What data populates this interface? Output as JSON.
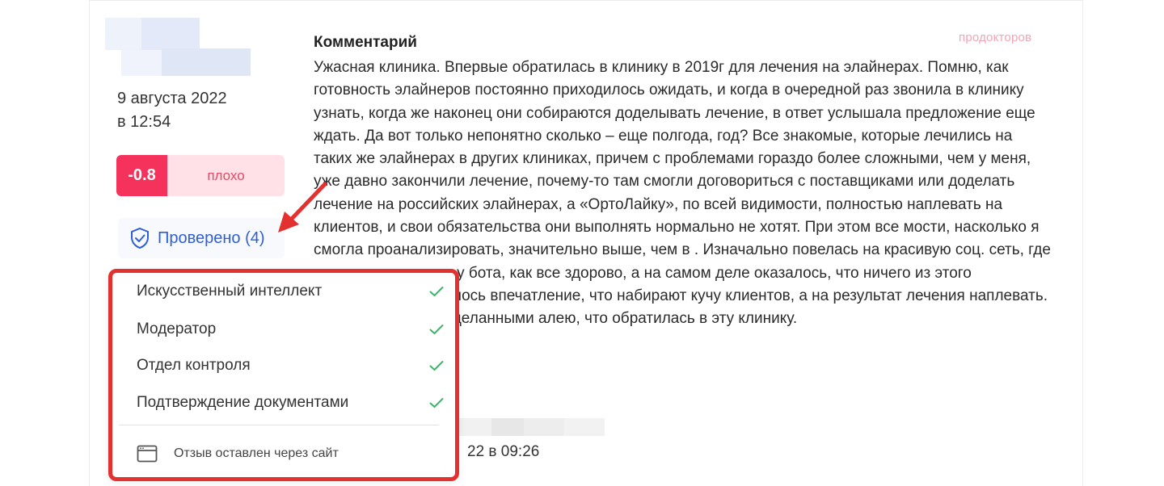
{
  "review": {
    "date_line1": "9 августа 2022",
    "date_line2": "в 12:54",
    "rating": {
      "score": "-0.8",
      "label": "плохо",
      "score_color": "#f5325c",
      "label_bg": "#ffe1e7"
    },
    "verified_label": "Проверено (4)",
    "comment_title": "Комментарий",
    "brand": "продокторов",
    "comment_text": "Ужасная клиника. Впервые обратилась в клинику в 2019г для лечения на элайнерах. Помню, как готовность элайнеров постоянно приходилось ожидать, и когда в очередной раз звонила в клинику узнать, когда же наконец они собираются доделывать лечение, в ответ услышала предложение еще ждать. Да вот только непонятно сколько – еще полгода, год? Все знакомые, которые лечились на таких же элайнерах в других клиниках, причем с проблемами гораздо более сложными, чем у меня, уже давно закончили лечение, почему-то там смогли договориться с поставщиками или доделать лечение на российских элайнерах, а «ОртоЛайку», по всей видимости, полностью наплевать на клиентов, и свои обязательства они выполнять нормально не хотят. При этом все                    мости, насколько я смогла проанализировать, значительно выше, чем в                    . Изначально повелась на красивую соц. сеть, где расписывают какая у                    бота, как все здорово, а на самом деле оказалось, что ничего из этого                    реальности. Сложилось впечатление, что набирают кучу клиентов,                    а на результат лечения наплевать. Теперь хожу с недоделанными                    алею, что обратилась в эту клинику.",
    "review_time": "22 в 09:26"
  },
  "popup": {
    "items": [
      {
        "label": "Искусственный интеллект"
      },
      {
        "label": "Модератор"
      },
      {
        "label": "Отдел контроля"
      },
      {
        "label": "Подтверждение документами"
      }
    ],
    "footer": "Отзыв оставлен через сайт",
    "check_color": "#3fb36b",
    "border_color": "#e3312f"
  }
}
